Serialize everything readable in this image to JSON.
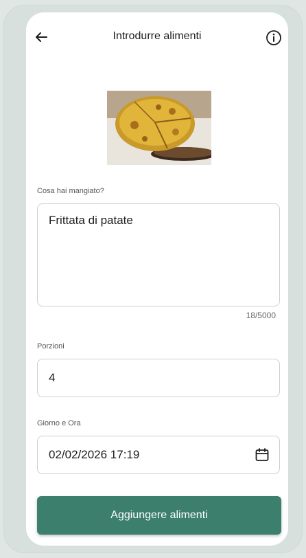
{
  "header": {
    "title": "Introdurre alimenti",
    "back_icon": "arrow-left-icon",
    "info_icon": "info-circle-icon"
  },
  "food_image": {
    "description_icon": "food-photo"
  },
  "meal": {
    "label": "Cosa hai mangiato?",
    "value": "Frittata di patate",
    "counter": "18/5000"
  },
  "portions": {
    "label": "Porzioni",
    "value": "4"
  },
  "datetime": {
    "label": "Giorno e Ora",
    "value": "02/02/2026 17:19",
    "icon": "calendar-icon"
  },
  "submit": {
    "label": "Aggiungere alimenti"
  },
  "colors": {
    "accent": "#3c7f6c",
    "background": "#dfe6e3"
  }
}
